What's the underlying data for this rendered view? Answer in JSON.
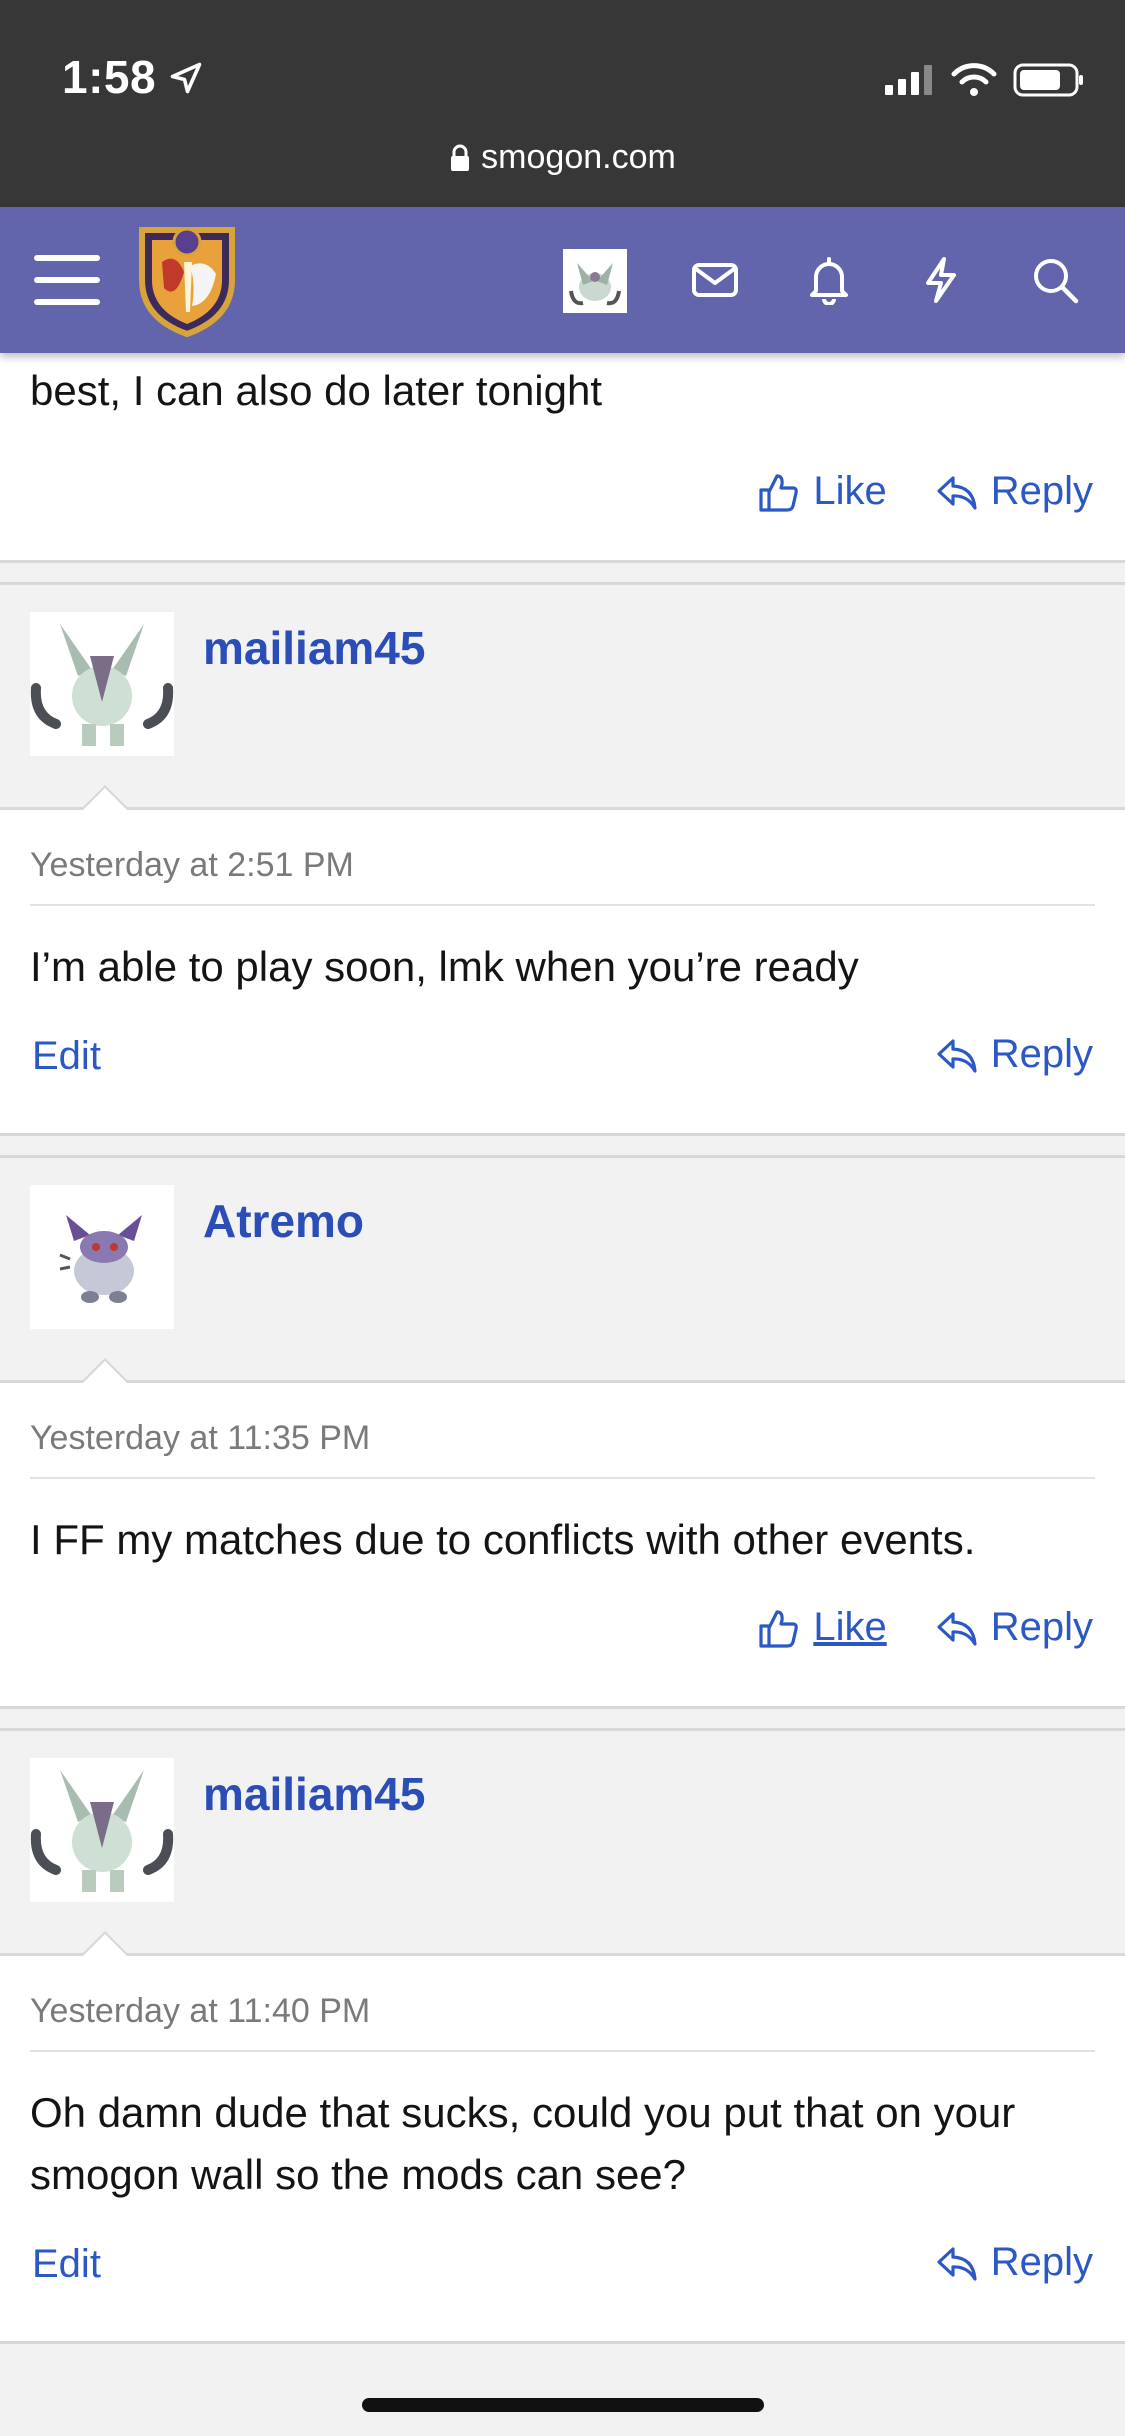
{
  "status_bar": {
    "time": "1:58",
    "url": "smogon.com"
  },
  "nav": {
    "icons": [
      "menu-icon",
      "site-logo",
      "user-avatar",
      "mail-icon",
      "bell-icon",
      "lightning-icon",
      "search-icon"
    ]
  },
  "colors": {
    "nav_bg": "#6264ac",
    "link": "#2b58c5",
    "username": "#2b4db8"
  },
  "top_post": {
    "text": "best, I can also do later tonight",
    "like_label": "Like",
    "reply_label": "Reply"
  },
  "posts": [
    {
      "username": "mailiam45",
      "date": "Yesterday at 2:51 PM",
      "message": "I’m able to play soon, lmk when you’re ready",
      "left_action": "Edit",
      "reply_label": "Reply"
    },
    {
      "username": "Atremo",
      "date": "Yesterday at 11:35 PM",
      "message": "I FF my matches due to conflicts with other events.",
      "like_label": "Like",
      "reply_label": "Reply"
    },
    {
      "username": "mailiam45",
      "date": "Yesterday at 11:40 PM",
      "message": "Oh damn dude that sucks, could you put that on your smogon wall so the mods can see?",
      "left_action": "Edit",
      "reply_label": "Reply"
    }
  ]
}
